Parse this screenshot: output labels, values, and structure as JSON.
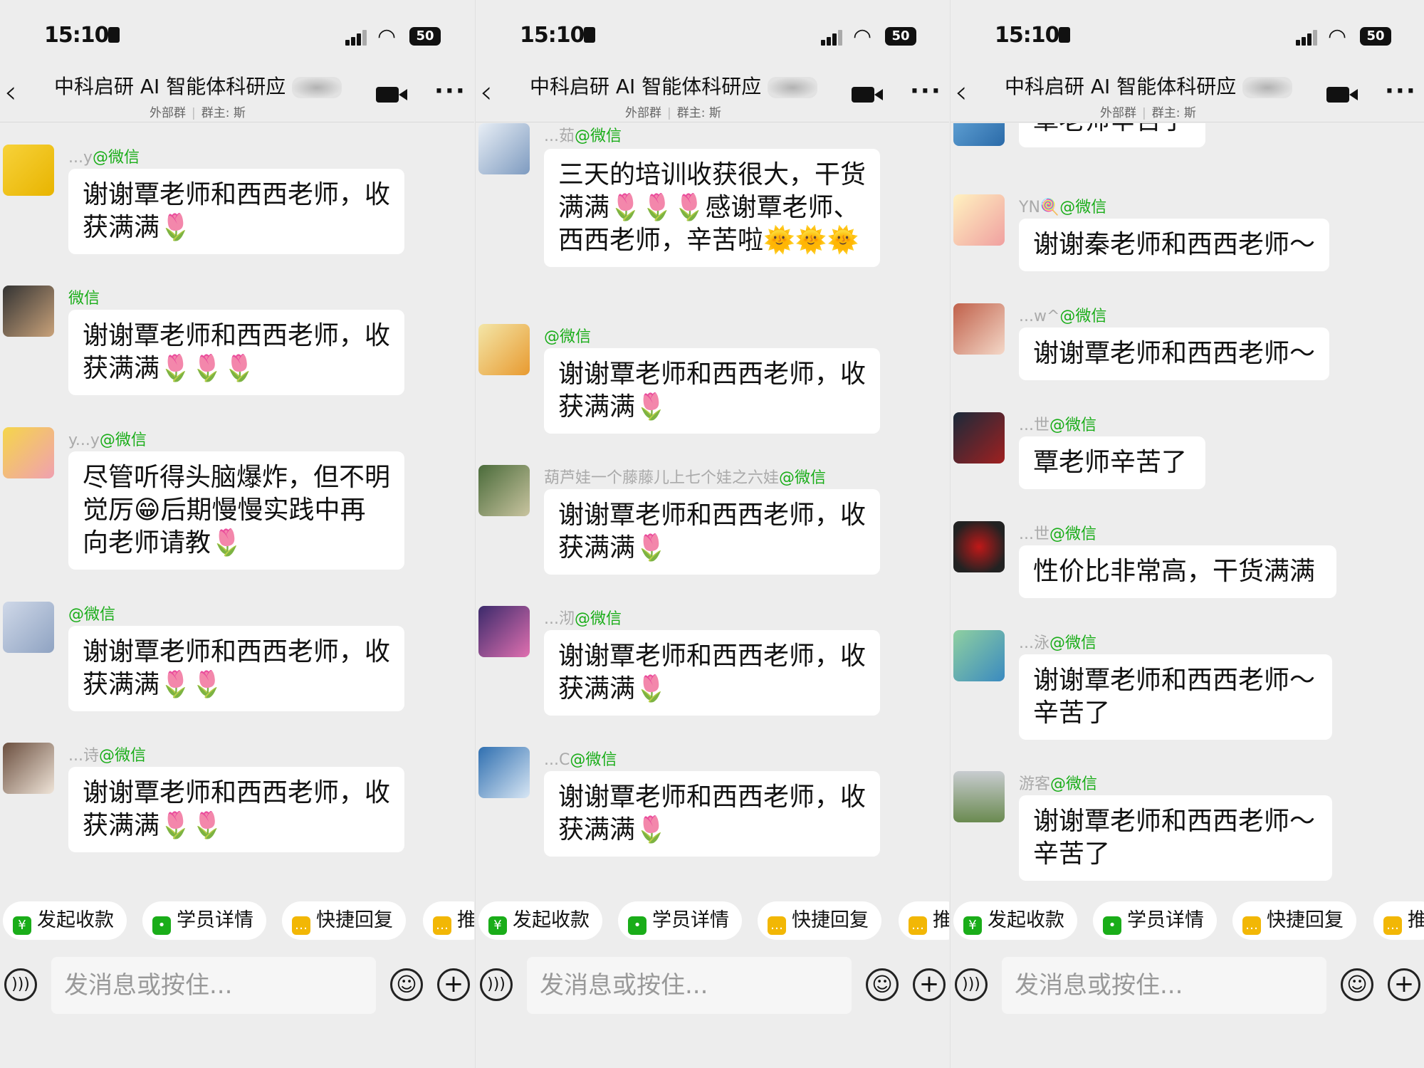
{
  "status": {
    "time": "15:10",
    "battery": "50"
  },
  "header": {
    "title": "中科启研 AI 智能体科研应",
    "subtitle_left": "外部群",
    "subtitle_right": "群主: 斯"
  },
  "quick_actions": [
    "发起收款",
    "学员详情",
    "快捷回复",
    "推"
  ],
  "input_placeholder": "发消息或按住...",
  "colors": {
    "wechat_tag": "#1aad19",
    "background": "#ededed",
    "bubble": "#ffffff"
  },
  "screens": [
    {
      "messages": [
        {
          "sender": "...y",
          "tag": "@微信",
          "text": "谢谢覃老师和西西老师，收获满满🌷"
        },
        {
          "sender": "",
          "tag": "微信",
          "text": "谢谢覃老师和西西老师，收获满满🌷🌷🌷"
        },
        {
          "sender": "y...y",
          "tag": "@微信",
          "text": "尽管听得头脑爆炸，但不明觉厉😁后期慢慢实践中再向老师请教🌷"
        },
        {
          "sender": "",
          "tag": "@微信",
          "text": "谢谢覃老师和西西老师，收获满满🌷🌷"
        },
        {
          "sender": "...诗",
          "tag": "@微信",
          "text": "谢谢覃老师和西西老师，收获满满🌷🌷"
        }
      ]
    },
    {
      "messages": [
        {
          "sender": "...茹",
          "tag": "@微信",
          "text": "三天的培训收获很大，干货满满🌷🌷🌷感谢覃老师、西西老师，辛苦啦🌞🌞🌞"
        },
        {
          "sender": "",
          "tag": "@微信",
          "text": "谢谢覃老师和西西老师，收获满满🌷"
        },
        {
          "sender": "葫芦娃一个藤藤儿上七个娃之六娃",
          "tag": "@微信",
          "text": "谢谢覃老师和西西老师，收获满满🌷"
        },
        {
          "sender": "...沏",
          "tag": "@微信",
          "text": "谢谢覃老师和西西老师，收获满满🌷"
        },
        {
          "sender": "...C",
          "tag": "@微信",
          "text": "谢谢覃老师和西西老师，收获满满🌷"
        }
      ]
    },
    {
      "messages": [
        {
          "sender": "",
          "tag": "",
          "text": "覃老师辛苦了"
        },
        {
          "sender": "YN🍭",
          "tag": "@微信",
          "text": "谢谢秦老师和西西老师～"
        },
        {
          "sender": "...w^",
          "tag": "@微信",
          "text": "谢谢覃老师和西西老师～"
        },
        {
          "sender": "...世",
          "tag": "@微信",
          "text": "覃老师辛苦了"
        },
        {
          "sender": "...世",
          "tag": "@微信",
          "text": "性价比非常高，干货满满"
        },
        {
          "sender": "...泳",
          "tag": "@微信",
          "text": "谢谢覃老师和西西老师～辛苦了"
        },
        {
          "sender": "游客",
          "tag": "@微信",
          "text": "谢谢覃老师和西西老师～辛苦了"
        }
      ]
    }
  ]
}
